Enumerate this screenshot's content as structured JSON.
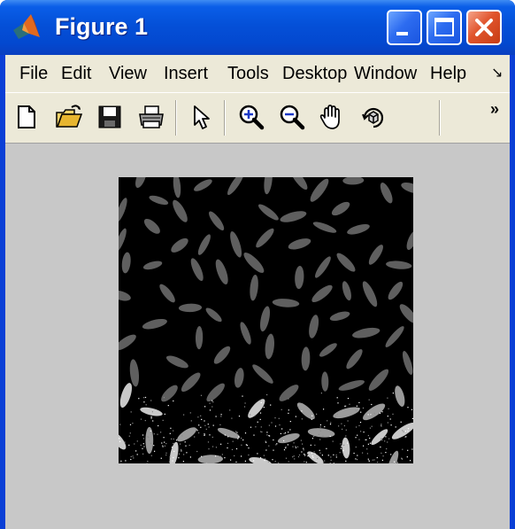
{
  "window": {
    "title": "Figure 1",
    "app_icon": "matlab-logo-icon",
    "controls": [
      "minimize-icon",
      "maximize-icon",
      "close-icon"
    ]
  },
  "menubar": {
    "items": [
      "File",
      "Edit",
      "View",
      "Insert",
      "Tools",
      "Desktop",
      "Window",
      "Help"
    ],
    "overflow_icon": "menu-overflow-icon"
  },
  "toolbar": {
    "tools": [
      "new-figure-icon",
      "open-file-icon",
      "save-figure-icon",
      "print-figure-icon",
      "edit-plot-arrow-icon",
      "zoom-in-icon",
      "zoom-out-icon",
      "pan-hand-icon",
      "rotate-3d-icon"
    ],
    "overflow_icon": "toolbar-overflow-icon"
  },
  "figure": {
    "content": "grayscale-rice-image",
    "colors": {
      "figure_background": "#c8c8c8",
      "image_background": "#000000",
      "grain_gray": "#5f5f5f",
      "grain_light": "#c9c9c9"
    }
  }
}
